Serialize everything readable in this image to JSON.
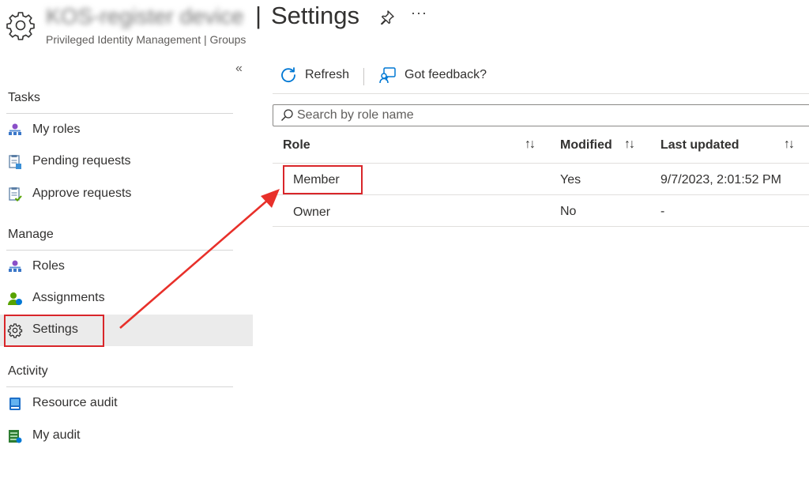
{
  "header": {
    "resource_name": "KOS-register device",
    "separator": "|",
    "title": "Settings",
    "subtitle": "Privileged Identity Management | Groups",
    "more": "···"
  },
  "sidebar": {
    "sections": [
      {
        "title": "Tasks",
        "items": [
          {
            "label": "My roles",
            "icon": "my-roles-icon"
          },
          {
            "label": "Pending requests",
            "icon": "pending-requests-icon"
          },
          {
            "label": "Approve requests",
            "icon": "approve-requests-icon"
          }
        ]
      },
      {
        "title": "Manage",
        "items": [
          {
            "label": "Roles",
            "icon": "roles-icon"
          },
          {
            "label": "Assignments",
            "icon": "assignments-icon"
          },
          {
            "label": "Settings",
            "icon": "gear-icon",
            "active": true
          }
        ]
      },
      {
        "title": "Activity",
        "items": [
          {
            "label": "Resource audit",
            "icon": "resource-audit-icon"
          },
          {
            "label": "My audit",
            "icon": "my-audit-icon"
          }
        ]
      }
    ],
    "collapse_glyph": "«"
  },
  "toolbar": {
    "refresh_label": "Refresh",
    "feedback_label": "Got feedback?"
  },
  "search": {
    "placeholder": "Search by role name",
    "value": ""
  },
  "table": {
    "columns": [
      {
        "label": "Role",
        "sort_glyph": "↑↓"
      },
      {
        "label": "Modified",
        "sort_glyph": "↑↓"
      },
      {
        "label": "Last updated",
        "sort_glyph": "↑↓"
      }
    ],
    "rows": [
      {
        "role": "Member",
        "modified": "Yes",
        "last_updated": "9/7/2023, 2:01:52 PM"
      },
      {
        "role": "Owner",
        "modified": "No",
        "last_updated": "-"
      }
    ]
  },
  "colors": {
    "accent": "#0078d4",
    "annotation_red": "#d9262a",
    "active_bg": "#ebebeb"
  }
}
